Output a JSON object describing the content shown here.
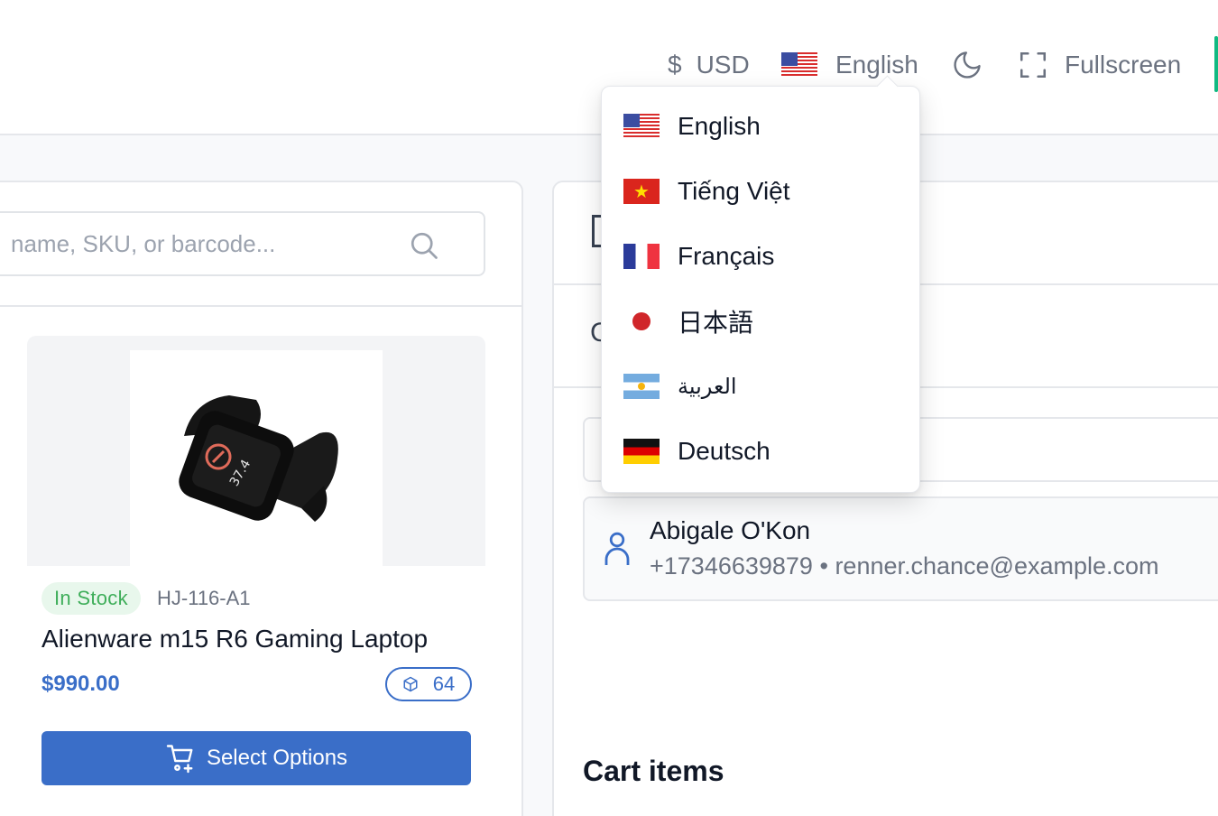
{
  "header": {
    "currency_symbol": "$",
    "currency": "USD",
    "language": "English",
    "fullscreen_label": "Fullscreen"
  },
  "language_menu": {
    "items": [
      {
        "label": "English",
        "flag": "us-flag"
      },
      {
        "label": "Tiếng Việt",
        "flag": "vn-flag"
      },
      {
        "label": "Français",
        "flag": "fr-flag"
      },
      {
        "label": "日本語",
        "flag": "jp-flag"
      },
      {
        "label": "العربية",
        "flag": "ar-flag"
      },
      {
        "label": "Deutsch",
        "flag": "de-flag"
      }
    ]
  },
  "search": {
    "placeholder": "name, SKU, or barcode..."
  },
  "product": {
    "stock_status": "In Stock",
    "sku": "HJ-116-A1",
    "name": "Alienware m15 R6 Gaming Laptop",
    "price": "$990.00",
    "quantity": "64",
    "select_label": "Select Options"
  },
  "customer": {
    "name": "Abigale O'Kon",
    "phone": "+17346639879",
    "separator": "•",
    "email": "renner.chance@example.com"
  },
  "cart": {
    "title": "Cart items"
  },
  "colors": {
    "primary": "#3a6ec8",
    "success": "#3fae5a",
    "accent": "#10b981"
  }
}
